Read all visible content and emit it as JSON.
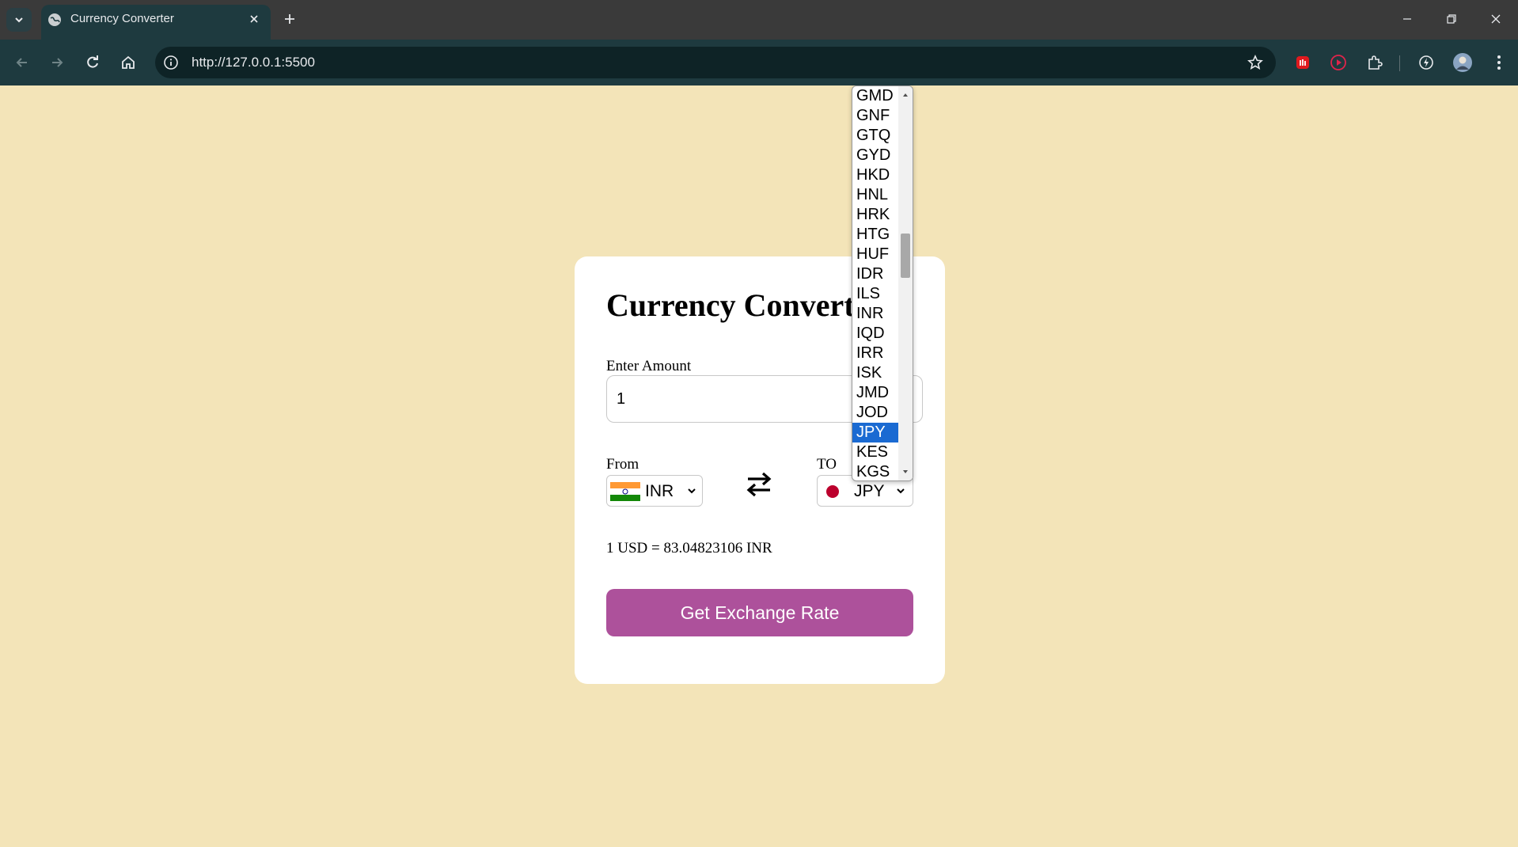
{
  "browser": {
    "tab_title": "Currency Converter",
    "url": "http://127.0.0.1:5500"
  },
  "page": {
    "title": "Currency Converter",
    "amount_label": "Enter Amount",
    "amount_value": "1",
    "from_label": "From",
    "to_label": "TO",
    "from_currency": "INR",
    "to_currency": "JPY",
    "rate_message": "1 USD = 83.04823106 INR",
    "button_label": "Get Exchange Rate"
  },
  "dropdown": {
    "options": [
      "GMD",
      "GNF",
      "GTQ",
      "GYD",
      "HKD",
      "HNL",
      "HRK",
      "HTG",
      "HUF",
      "IDR",
      "ILS",
      "INR",
      "IQD",
      "IRR",
      "ISK",
      "JMD",
      "JOD",
      "JPY",
      "KES",
      "KGS"
    ],
    "selected": "JPY"
  },
  "colors": {
    "page_background": "#f3e4b8",
    "button": "#ad519b",
    "selected_option": "#1a6ad2",
    "browser_toolbar": "#1e3a3f"
  },
  "icons": {
    "from_flag": "india-flag-icon",
    "to_flag": "japan-flag-icon",
    "swap": "swap-arrows-icon"
  }
}
